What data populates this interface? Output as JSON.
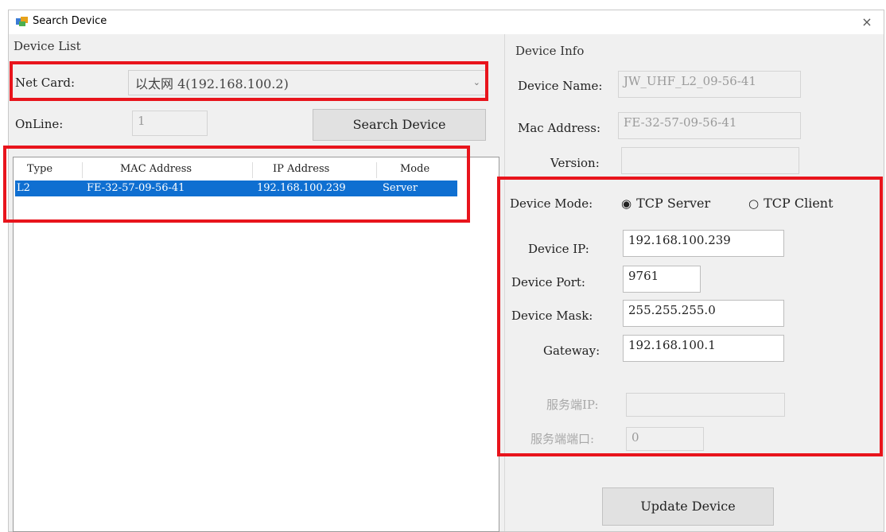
{
  "window": {
    "title": "Search Device",
    "close_icon": "×"
  },
  "device_list": {
    "group_title": "Device List",
    "net_card_label": "Net Card:",
    "net_card_value": "以太网 4(192.168.100.2)",
    "online_label": "OnLine:",
    "online_value": "1",
    "search_button": "Search Device",
    "columns": [
      "Type",
      "MAC Address",
      "IP Address",
      "Mode"
    ],
    "rows": [
      {
        "type": "L2",
        "mac": "FE-32-57-09-56-41",
        "ip": "192.168.100.239",
        "mode": "Server"
      }
    ]
  },
  "device_info": {
    "group_title": "Device Info",
    "name_label": "Device Name:",
    "name_value": "JW_UHF_L2_09-56-41",
    "mac_label": "Mac Address:",
    "mac_value": "FE-32-57-09-56-41",
    "version_label": "Version:",
    "version_value": "",
    "mode_label": "Device Mode:",
    "mode_options": [
      "TCP Server",
      "TCP Client"
    ],
    "mode_selected": "TCP Server",
    "ip_label": "Device IP:",
    "ip_value": "192.168.100.239",
    "port_label": "Device Port:",
    "port_value": "9761",
    "mask_label": "Device Mask:",
    "mask_value": "255.255.255.0",
    "gateway_label": "Gateway:",
    "gateway_value": "192.168.100.1",
    "server_ip_label": "服务端IP:",
    "server_ip_value": "",
    "server_port_label": "服务端端口:",
    "server_port_value": "0",
    "update_button": "Update Device"
  },
  "colors": {
    "highlight": "#e8141c",
    "selection": "#0f6fd1"
  }
}
